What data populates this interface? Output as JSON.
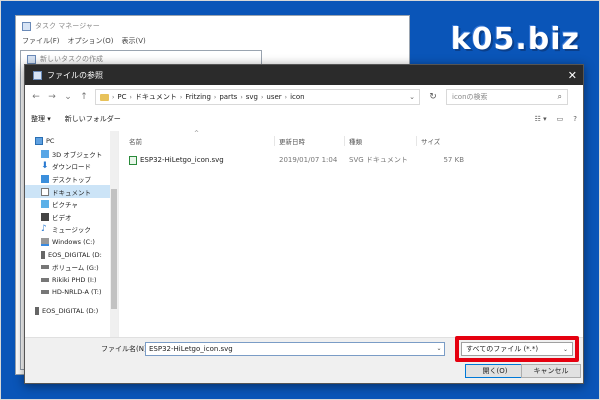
{
  "logo": "k05.biz",
  "task_manager": {
    "title": "タスク マネージャー",
    "menu": [
      "ファイル(F)",
      "オプション(O)",
      "表示(V)"
    ]
  },
  "new_task": {
    "title": "新しいタスクの作成"
  },
  "dialog": {
    "title": "ファイルの参照",
    "address": [
      "PC",
      "ドキュメント",
      "Fritzing",
      "parts",
      "svg",
      "user",
      "icon"
    ],
    "search_placeholder": "iconの検索",
    "toolbar": {
      "organize": "整理 ▾",
      "new_folder": "新しいフォルダー"
    },
    "tree": [
      {
        "label": "PC"
      },
      {
        "label": "3D オブジェクト"
      },
      {
        "label": "ダウンロード"
      },
      {
        "label": "デスクトップ"
      },
      {
        "label": "ドキュメント"
      },
      {
        "label": "ピクチャ"
      },
      {
        "label": "ビデオ"
      },
      {
        "label": "ミュージック"
      },
      {
        "label": "Windows (C:)"
      },
      {
        "label": "EOS_DIGITAL (D:"
      },
      {
        "label": "ボリューム (G:)"
      },
      {
        "label": "Rikiki PHD (I:)"
      },
      {
        "label": "HD-NRLD-A (T:)"
      },
      {
        "label": "EOS_DIGITAL (D:)"
      }
    ],
    "columns": {
      "name": "名前",
      "date": "更新日時",
      "type": "種類",
      "size": "サイズ"
    },
    "files": [
      {
        "name": "ESP32-HiLetgo_icon.svg",
        "date": "2019/01/07 1:04",
        "type": "SVG ドキュメント",
        "size": "57 KB"
      }
    ],
    "filename_label": "ファイル名(N):",
    "filename_value": "ESP32-HiLetgo_icon.svg",
    "filter_value": "すべてのファイル (*.*)",
    "open_label": "開く(O)",
    "cancel_label": "キャンセル"
  },
  "colors": {
    "desktop": "#0a55b8",
    "highlight": "#e5000f",
    "selection": "#cce4f7"
  }
}
